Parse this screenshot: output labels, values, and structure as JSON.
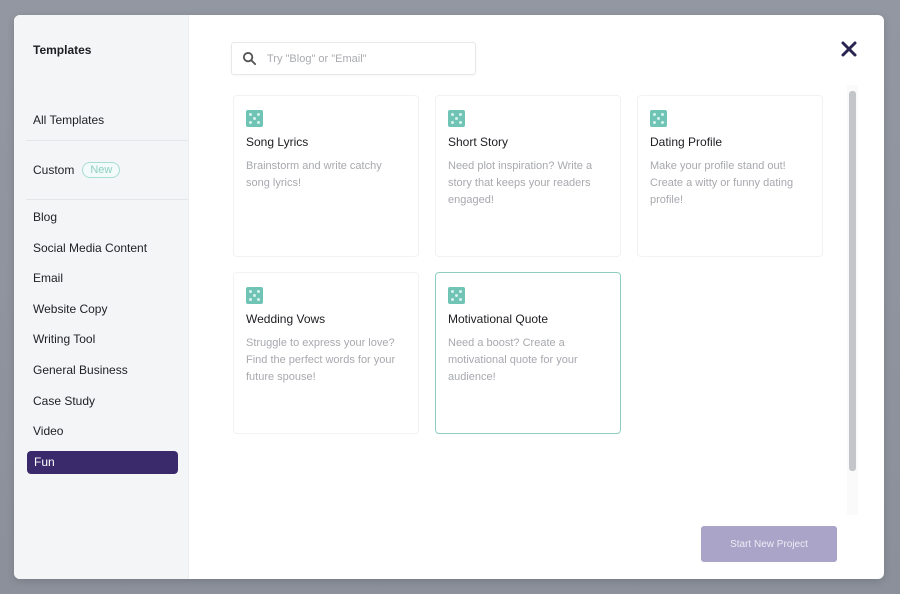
{
  "sidebar": {
    "title": "Templates",
    "all_templates": "All Templates",
    "custom": {
      "label": "Custom",
      "badge": "New"
    },
    "categories": [
      {
        "label": "Blog",
        "active": false
      },
      {
        "label": "Social Media Content",
        "active": false
      },
      {
        "label": "Email",
        "active": false
      },
      {
        "label": "Website Copy",
        "active": false
      },
      {
        "label": "Writing Tool",
        "active": false
      },
      {
        "label": "General Business",
        "active": false
      },
      {
        "label": "Case Study",
        "active": false
      },
      {
        "label": "Video",
        "active": false
      },
      {
        "label": "Fun",
        "active": true
      }
    ]
  },
  "search": {
    "placeholder": "Try \"Blog\" or \"Email\"",
    "value": "",
    "icon": "search-icon"
  },
  "close": {
    "icon": "close-icon"
  },
  "templates": [
    {
      "title": "Song Lyrics",
      "description": "Brainstorm and write catchy song lyrics!",
      "selected": false
    },
    {
      "title": "Short Story",
      "description": "Need plot inspiration? Write a story that keeps your readers engaged!",
      "selected": false
    },
    {
      "title": "Dating Profile",
      "description": "Make your profile stand out! Create a witty or funny dating profile!",
      "selected": false
    },
    {
      "title": "Wedding Vows",
      "description": "Struggle to express your love? Find the perfect words for your future spouse!",
      "selected": false
    },
    {
      "title": "Motivational Quote",
      "description": "Need a boost? Create a motivational quote for your audience!",
      "selected": true
    }
  ],
  "footer": {
    "start_button": "Start New Project"
  },
  "colors": {
    "accent": "#3a2a6b",
    "teal": "#6fc4b6",
    "button_disabled": "#aaa4c8"
  }
}
